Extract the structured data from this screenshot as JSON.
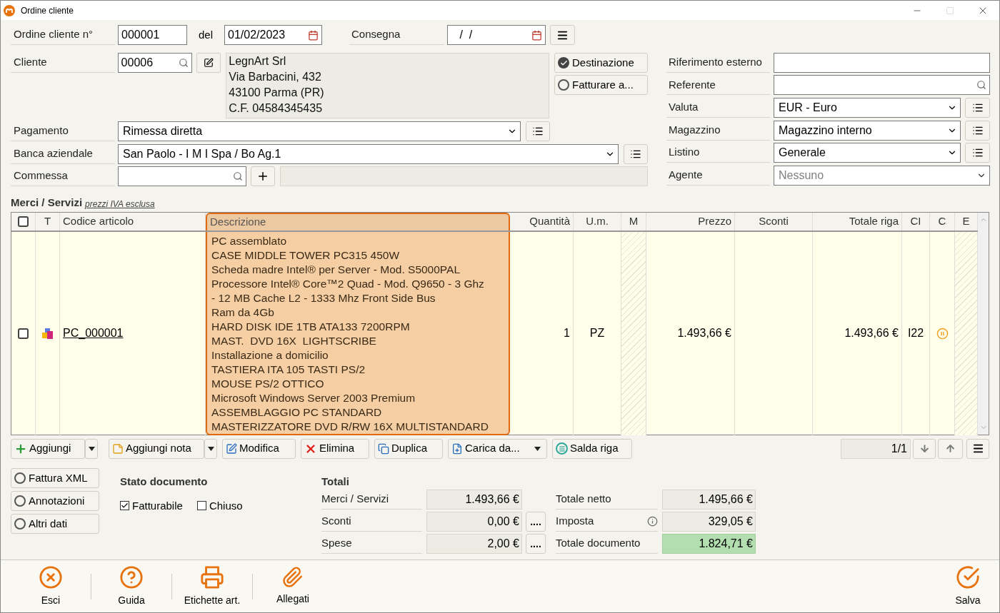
{
  "window": {
    "title": "Ordine cliente"
  },
  "header": {
    "order": {
      "label": "Ordine cliente n°",
      "value": "000001"
    },
    "date": {
      "label": "del",
      "value": "01/02/2023"
    },
    "delivery": {
      "label": "Consegna",
      "value": " /  /"
    }
  },
  "customer": {
    "label": "Cliente",
    "code": "00006",
    "address_lines": [
      "LegnArt Srl",
      "Via Barbacini, 432",
      "43100 Parma (PR)",
      "C.F. 04584345435"
    ],
    "options": [
      {
        "label": "Destinazione",
        "selected": true
      },
      {
        "label": "Fatturare a...",
        "selected": false
      }
    ]
  },
  "payment": {
    "label": "Pagamento",
    "value": "Rimessa diretta"
  },
  "bank": {
    "label": "Banca aziendale",
    "value": "San Paolo - I M I Spa / Bo Ag.1"
  },
  "project": {
    "label": "Commessa"
  },
  "right_fields": [
    {
      "kind": "text",
      "label": "Riferimento esterno"
    },
    {
      "kind": "search",
      "label": "Referente"
    },
    {
      "kind": "select_list",
      "label": "Valuta",
      "value": "EUR - Euro"
    },
    {
      "kind": "select_list",
      "label": "Magazzino",
      "value": "Magazzino interno"
    },
    {
      "kind": "select_list",
      "label": "Listino",
      "value": "Generale"
    },
    {
      "kind": "select",
      "label": "Agente",
      "placeholder": "Nessuno"
    }
  ],
  "items": {
    "title": "Merci / Servizi",
    "note": "prezzi IVA esclusa"
  },
  "table": {
    "columns": [
      {
        "label": "T",
        "selected": false
      },
      {
        "label": "Codice articolo",
        "selected": false
      },
      {
        "label": "Descrizione",
        "selected": true
      },
      {
        "label": "Quantità",
        "selected": false
      },
      {
        "label": "U.m.",
        "selected": false
      },
      {
        "label": "M",
        "selected": false
      },
      {
        "label": "Prezzo",
        "selected": false
      },
      {
        "label": "Sconti",
        "selected": false
      },
      {
        "label": "Totale riga",
        "selected": false
      },
      {
        "label": "CI",
        "selected": false
      },
      {
        "label": "C",
        "selected": false
      },
      {
        "label": "E",
        "selected": false
      }
    ],
    "all_checked": false,
    "rows": [
      {
        "checked": false,
        "code": "PC_000001",
        "description_lines": [
          "PC assemblato",
          "CASE MIDDLE TOWER PC315 450W",
          "Scheda madre Intel® per Server - Mod. S5000PAL",
          "Processore Intel® Core™2 Quad - Mod. Q9650 - 3 Ghz",
          "- 12 MB Cache L2 - 1333 Mhz Front Side Bus",
          "Ram da 4Gb",
          "HARD DISK IDE 1TB ATA133 7200RPM",
          "MAST.  DVD 16X  LIGHTSCRIBE",
          "Installazione a domicilio",
          "TASTIERA ITA 105 TASTI PS/2",
          "MOUSE PS/2 OTTICO",
          "Microsoft Windows Server 2003 Premium",
          "ASSEMBLAGGIO PC STANDARD",
          "MASTERIZZATORE DVD R/RW 16X MULTISTANDARD"
        ],
        "quantity": "1",
        "unit": "PZ",
        "price": "1.493,66 €",
        "total": "1.493,66 €",
        "vat": "I22"
      }
    ]
  },
  "toolbar": [
    {
      "kind": "add",
      "label": "Aggiungi",
      "split": true
    },
    {
      "kind": "note",
      "label": "Aggiungi nota",
      "split": true
    },
    {
      "kind": "edit",
      "label": "Modifica",
      "split": false
    },
    {
      "kind": "delete",
      "label": "Elimina",
      "split": false
    },
    {
      "kind": "duplicate",
      "label": "Duplica",
      "split": false
    },
    {
      "kind": "load",
      "label": "Carica da...",
      "split": false
    },
    {
      "kind": "settle",
      "label": "Salda riga",
      "split": false
    }
  ],
  "pager": "1/1",
  "side_options": [
    {
      "label": "Fattura XML",
      "selected": false
    },
    {
      "label": "Annotazioni",
      "selected": false
    },
    {
      "label": "Altri dati",
      "selected": false
    }
  ],
  "status": {
    "title": "Stato documento",
    "checks": [
      {
        "label": "Fatturabile",
        "checked": true
      },
      {
        "label": "Chiuso",
        "checked": false
      }
    ]
  },
  "totals": {
    "title": "Totali",
    "left": [
      {
        "label": "Merci / Servizi",
        "value": "1.493,66 €"
      },
      {
        "label": "Sconti",
        "value": "0,00 €",
        "button": "...."
      },
      {
        "label": "Spese",
        "value": "2,00 €",
        "button": "...."
      }
    ],
    "right": [
      {
        "label": "Totale netto",
        "value": "1.495,66 €",
        "info": false,
        "highlight": false
      },
      {
        "label": "Imposta",
        "value": "329,05 €",
        "info": true,
        "highlight": false
      },
      {
        "label": "Totale documento",
        "value": "1.824,71 €",
        "info": false,
        "highlight": true
      }
    ]
  },
  "footer": {
    "left": [
      {
        "kind": "exit",
        "label": "Esci"
      },
      {
        "kind": "help",
        "label": "Guida"
      },
      {
        "kind": "labels",
        "label": "Etichette art."
      },
      {
        "kind": "attachments",
        "label": "Allegati"
      }
    ],
    "right": [
      {
        "kind": "save",
        "label": "Salva"
      }
    ]
  }
}
